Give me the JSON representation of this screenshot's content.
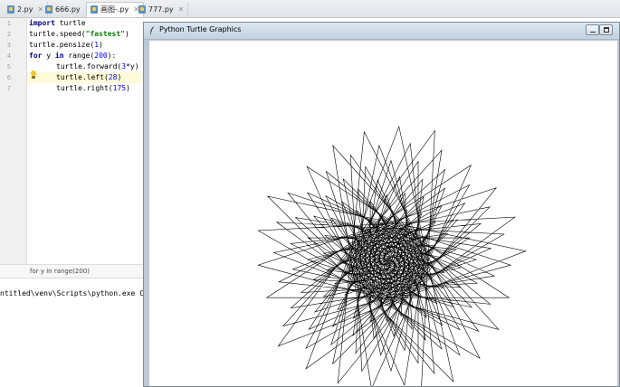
{
  "ide": {
    "tabs": [
      {
        "label": "2.py",
        "active": false
      },
      {
        "label": "666.py",
        "active": false
      },
      {
        "label": "画图-.py",
        "active": true
      },
      {
        "label": "777.py",
        "active": false
      }
    ],
    "line_numbers": [
      "1",
      "2",
      "3",
      "4",
      "5",
      "6",
      "7"
    ],
    "code": {
      "l1_kw": "import",
      "l1_rest": " turtle",
      "l2_a": "turtle.speed(",
      "l2_str": "\"fastest\"",
      "l2_b": ")",
      "l3_a": "turtle.pensize(",
      "l3_num": "1",
      "l3_b": ")",
      "l4_kw1": "for",
      "l4_a": " y ",
      "l4_kw2": "in",
      "l4_b": " range(",
      "l4_num": "200",
      "l4_c": "):",
      "l5_a": "turtle.forward(",
      "l5_num": "3",
      "l5_b": "*y)",
      "l6_a": "turtle.left(",
      "l6_num": "28",
      "l6_b": ")",
      "l7_a": "turtle.right(",
      "l7_num": "175",
      "l7_b": ")"
    },
    "breadcrumb": "for y in range(200)",
    "console_line": "ntitled\\venv\\Scripts\\python.exe C:/"
  },
  "turtle_window": {
    "title": "Python Turtle Graphics",
    "icon": "feather-icon",
    "drawing": {
      "program": "for y in range(200): forward(3*y); left(28); right(175)",
      "iterations": 200,
      "pen_color": "#000000"
    }
  },
  "colors": {
    "keyword": "#000080",
    "string": "#008000",
    "number": "#0000ff",
    "highlight_line": "#fffbd8"
  }
}
